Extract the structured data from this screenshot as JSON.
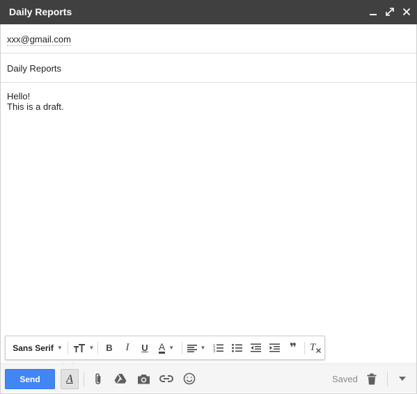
{
  "window": {
    "title": "Daily Reports",
    "controls": [
      "minimize-icon",
      "expand-icon",
      "close-icon"
    ]
  },
  "compose": {
    "to": "xxx@gmail.com",
    "subject": "Daily Reports",
    "body_lines": [
      "Hello!",
      "This is a draft."
    ]
  },
  "formatting_bar": {
    "font": "Sans Serif",
    "tools": [
      "text-size-icon",
      "bold-icon",
      "italic-icon",
      "underline-icon",
      "text-color-icon",
      "align-icon",
      "numbered-list-icon",
      "bulleted-list-icon",
      "indent-less-icon",
      "indent-more-icon",
      "quote-icon",
      "remove-formatting-icon"
    ],
    "bold_glyph": "B",
    "italic_glyph": "I",
    "underline_glyph": "U",
    "text_color_glyph": "A",
    "quote_glyph": "❞",
    "clear_glyph": "T"
  },
  "bottom_bar": {
    "send_label": "Send",
    "format_toggle_glyph": "A",
    "status": "Saved",
    "icons": [
      "attach-icon",
      "drive-icon",
      "camera-icon",
      "link-icon",
      "emoji-icon",
      "trash-icon",
      "more-options-icon"
    ]
  },
  "colors": {
    "titlebar": "#404040",
    "send": "#4285f4"
  }
}
